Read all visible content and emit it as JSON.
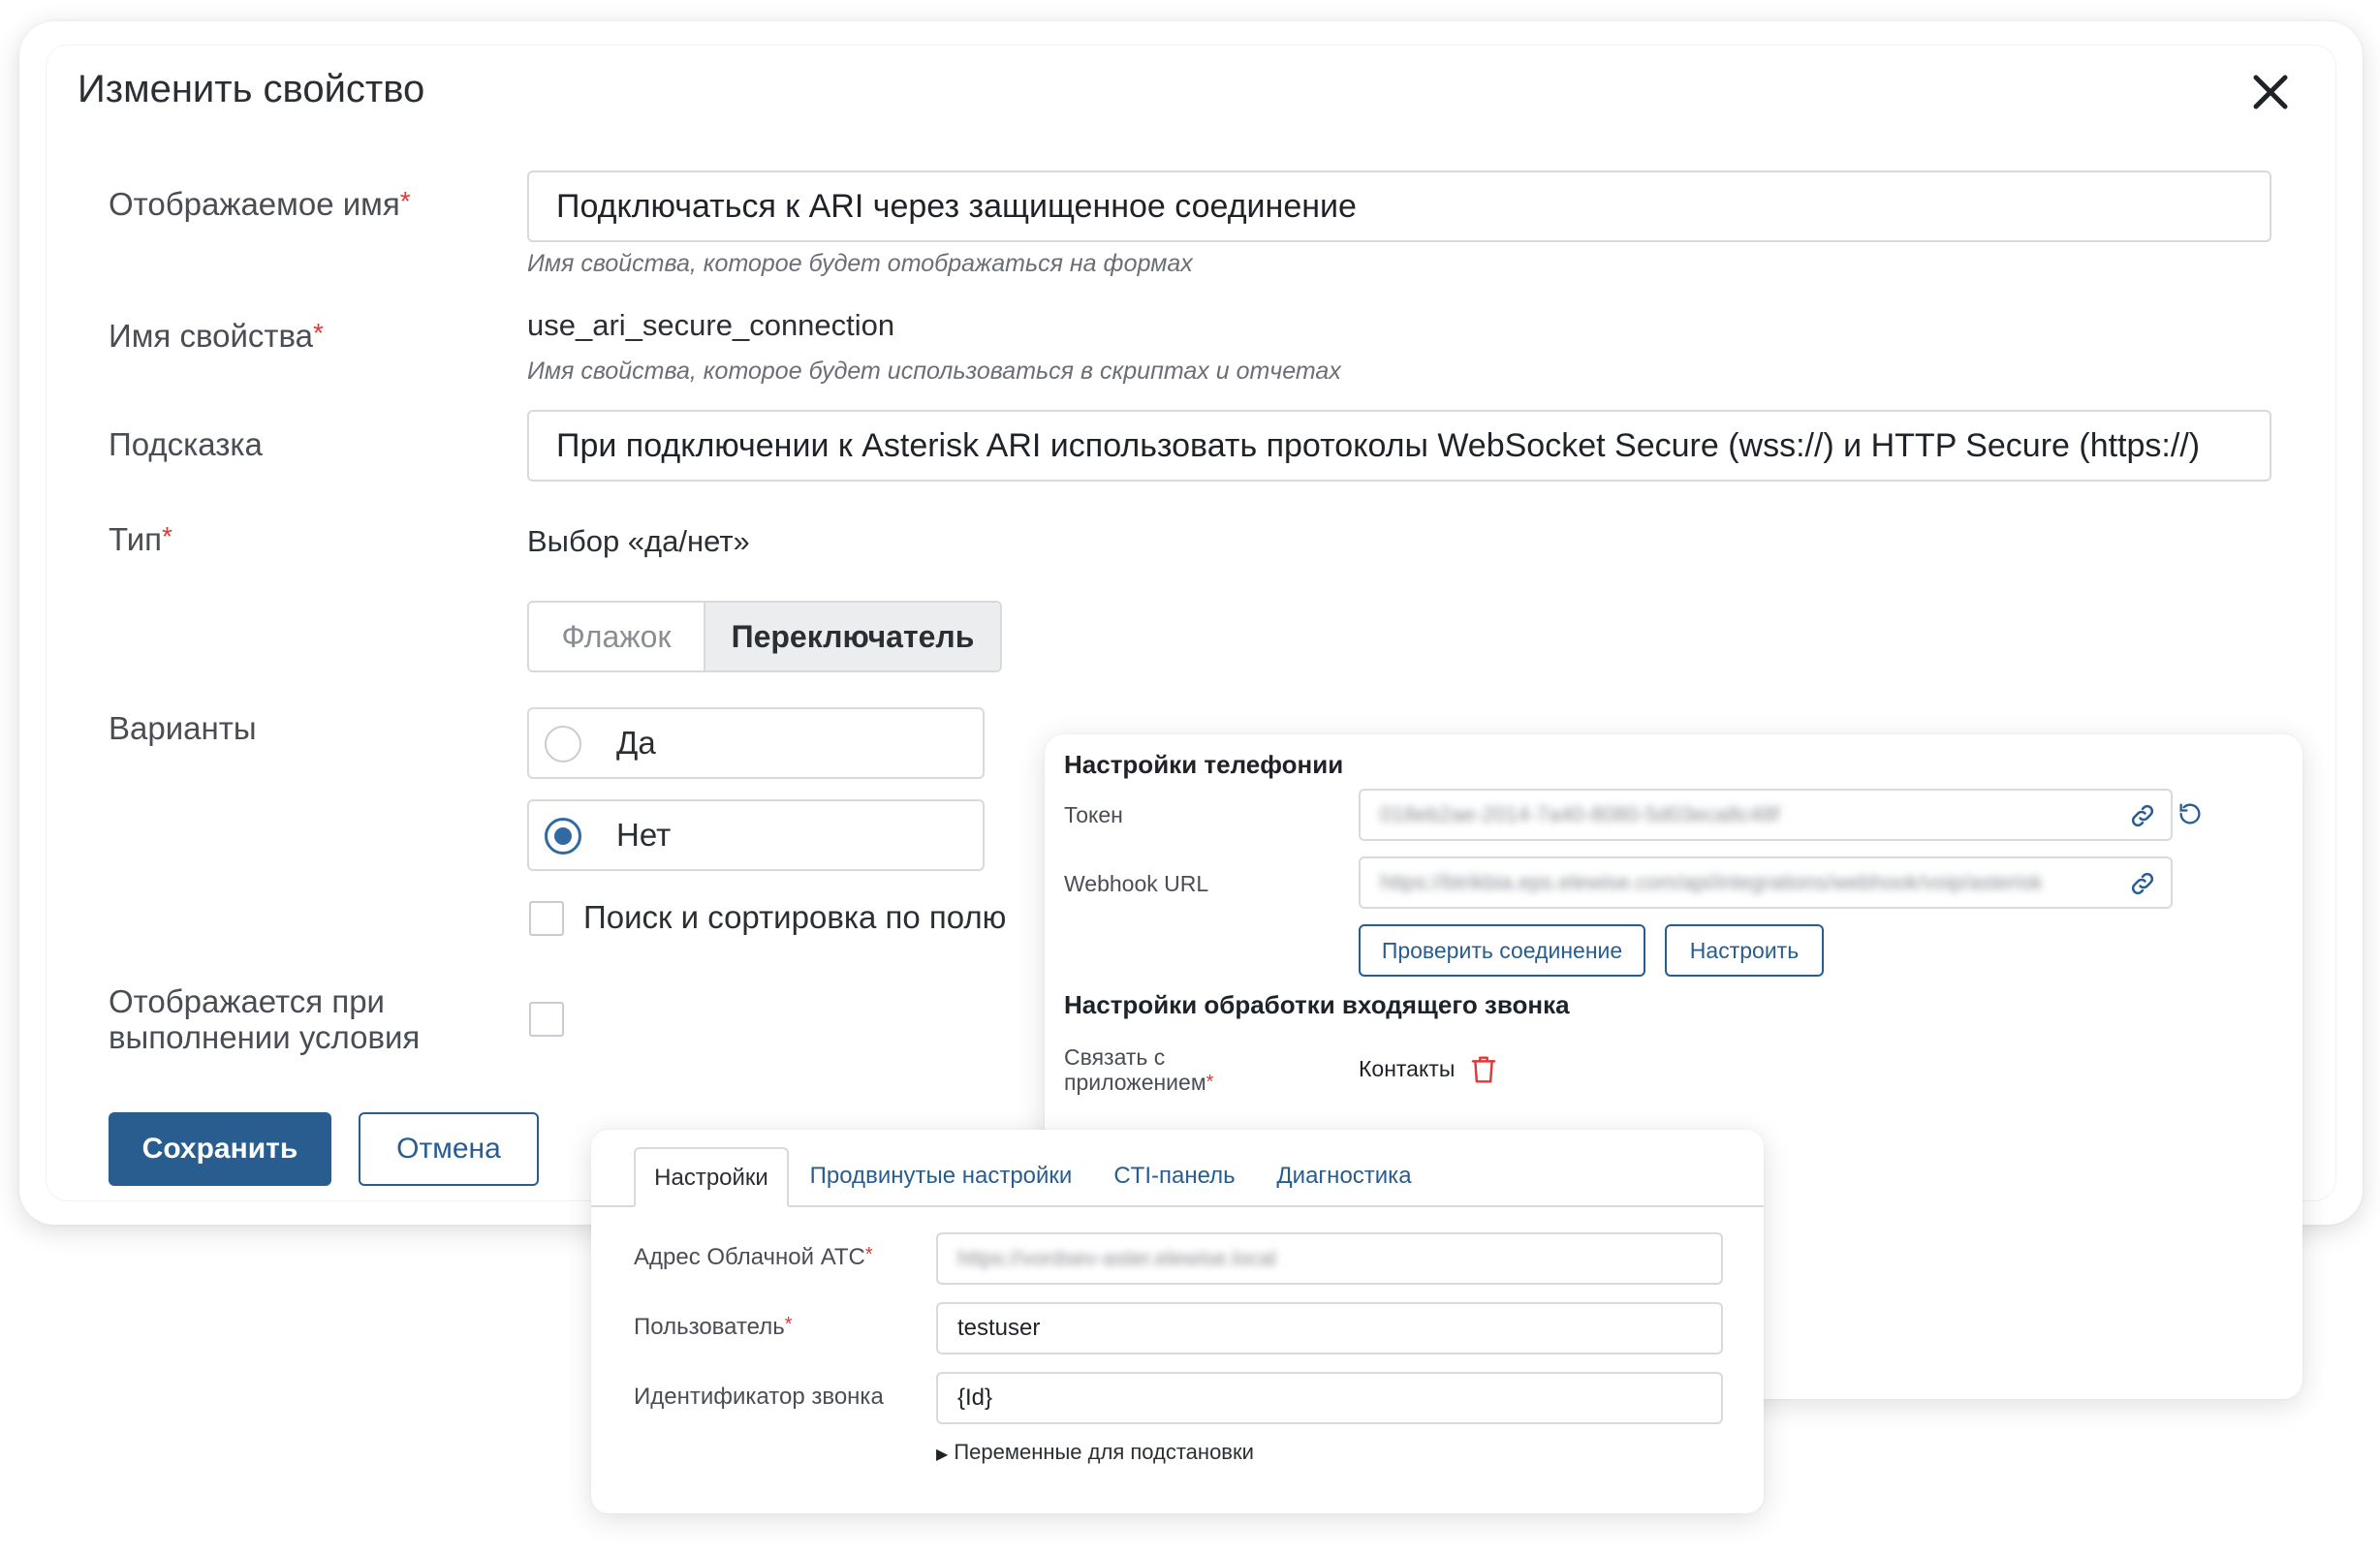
{
  "dialog": {
    "title": "Изменить свойство",
    "display_name": {
      "label": "Отображаемое имя",
      "required": "*",
      "value": "Подключаться к ARI через защищенное соединение",
      "hint": "Имя свойства, которое будет отображаться на формах"
    },
    "property_name": {
      "label": "Имя свойства",
      "required": "*",
      "value": "use_ari_secure_connection",
      "hint": "Имя свойства, которое будет использоваться в скриптах и отчетах"
    },
    "tooltip": {
      "label": "Подсказка",
      "value": "При подключении к Asterisk ARI использовать протоколы WebSocket Secure (wss://) и HTTP Secure (https://)"
    },
    "type": {
      "label": "Тип",
      "required": "*",
      "value": "Выбор «да/нет»",
      "segments": [
        {
          "label": "Флажок",
          "selected": false
        },
        {
          "label": "Переключатель",
          "selected": true
        }
      ]
    },
    "variants": {
      "label": "Варианты",
      "options": [
        {
          "label": "Да",
          "checked": false
        },
        {
          "label": "Нет",
          "checked": true
        }
      ],
      "search_sort_label": "Поиск и сортировка по полю"
    },
    "conditional": {
      "label_line1": "Отображается при",
      "label_line2": "выполнении условия"
    },
    "save_label": "Сохранить",
    "cancel_label": "Отмена"
  },
  "telephony": {
    "title": "Настройки телефонии",
    "token_label": "Токен",
    "token_value": "018eb2ae-2014-7a40-8080-5d03eca8c48f",
    "webhook_label": "Webhook URL",
    "webhook_value": "https://btrikbia.eps.elewise.com/api/integrations/webhook/voip/asterisk",
    "check_button": "Проверить соединение",
    "configure_button": "Настроить",
    "incoming_title": "Настройки обработки входящего звонка",
    "link_label_line1": "Связать с",
    "link_label_line2": "приложением",
    "required": "*",
    "link_value": "Контакты"
  },
  "settings_panel": {
    "tabs": [
      "Настройки",
      "Продвинутые настройки",
      "CTI-панель",
      "Диагностика"
    ],
    "active_tab": "Настройки",
    "pbx_label": "Адрес Облачной АТС",
    "pbx_value": "https://vordsev-aster.elewise.local",
    "user_label": "Пользователь",
    "user_value": "testuser",
    "call_id_label": "Идентификатор звонка",
    "call_id_value": "{Id}",
    "required": "*",
    "variables_label": "Переменные для подстановки"
  },
  "colors": {
    "primary": "#2a5d8f",
    "required": "#d93a3a",
    "delete": "#d93a3a"
  }
}
